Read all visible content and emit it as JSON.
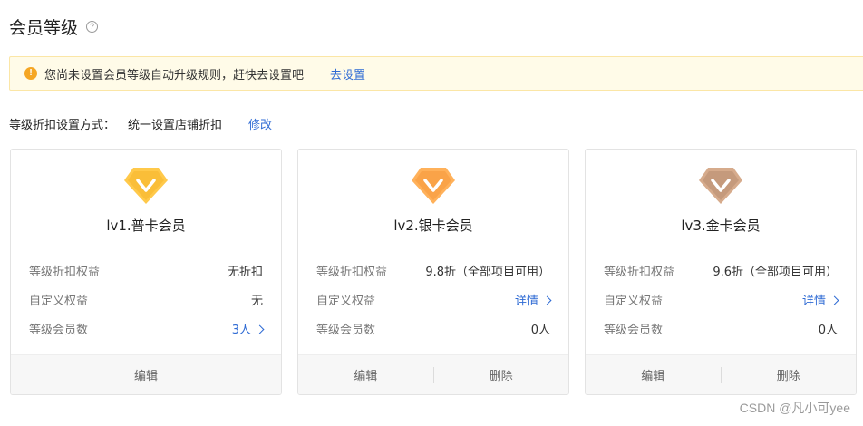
{
  "header": {
    "title": "会员等级",
    "help_glyph": "?"
  },
  "notice": {
    "icon_glyph": "!",
    "message": "您尚未设置会员等级自动升级规则，赶快去设置吧",
    "action": "去设置",
    "accent": "#f5a623"
  },
  "discount_setting": {
    "label": "等级折扣设置方式：",
    "value": "统一设置店铺折扣",
    "action": "修改"
  },
  "cards": [
    {
      "name": "lv1.普卡会员",
      "badge_colors": [
        "#ffc94a",
        "#f2a818"
      ],
      "rows": [
        {
          "key": "等级折扣权益",
          "value": "无折扣"
        },
        {
          "key": "自定义权益",
          "value": "无"
        },
        {
          "key": "等级会员数",
          "value": "3人"
        }
      ],
      "footer": [
        "编辑"
      ]
    },
    {
      "name": "lv2.银卡会员",
      "badge_colors": [
        "#ffb15a",
        "#f08a28"
      ],
      "rows": [
        {
          "key": "等级折扣权益",
          "value": "9.8折（全部项目可用）"
        },
        {
          "key": "自定义权益",
          "value": "详情"
        },
        {
          "key": "等级会员数",
          "value": "0人"
        }
      ],
      "footer": [
        "编辑",
        "删除"
      ]
    },
    {
      "name": "lv3.金卡会员",
      "badge_colors": [
        "#d6ab8c",
        "#a77c5e"
      ],
      "rows": [
        {
          "key": "等级折扣权益",
          "value": "9.6折（全部项目可用）"
        },
        {
          "key": "自定义权益",
          "value": "详情"
        },
        {
          "key": "等级会员数",
          "value": "0人"
        }
      ],
      "footer": [
        "编辑",
        "删除"
      ]
    }
  ],
  "colors": {
    "link": "#2f6bd4",
    "card_border": "#e3e3e3",
    "footer_bg": "#f7f7f7"
  },
  "watermark": "CSDN @凡小可yee"
}
